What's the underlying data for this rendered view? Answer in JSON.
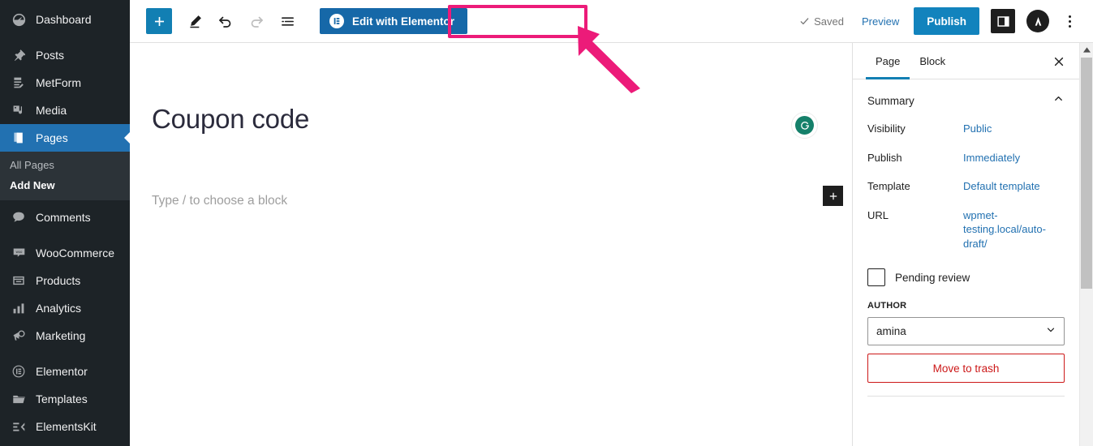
{
  "colors": {
    "admin_bg": "#1d2327",
    "admin_current": "#2271b1",
    "accent_blue": "#127fb3",
    "elementor_blue": "#1668a8",
    "highlight_pink": "#ec1b79",
    "link_blue": "#2271b1",
    "danger_red": "#cc1818",
    "grammarly_green": "#15806a"
  },
  "sidebar": {
    "items": [
      {
        "label": "Dashboard",
        "icon": "dashboard-icon",
        "current": false
      },
      {
        "label": "Posts",
        "icon": "pin-icon",
        "current": false
      },
      {
        "label": "MetForm",
        "icon": "form-icon",
        "current": false
      },
      {
        "label": "Media",
        "icon": "media-icon",
        "current": false
      },
      {
        "label": "Pages",
        "icon": "pages-icon",
        "current": true
      },
      {
        "label": "Comments",
        "icon": "comment-icon",
        "current": false
      },
      {
        "label": "WooCommerce",
        "icon": "woo-icon",
        "current": false
      },
      {
        "label": "Products",
        "icon": "products-icon",
        "current": false
      },
      {
        "label": "Analytics",
        "icon": "analytics-icon",
        "current": false
      },
      {
        "label": "Marketing",
        "icon": "megaphone-icon",
        "current": false
      },
      {
        "label": "Elementor",
        "icon": "elementor-icon",
        "current": false
      },
      {
        "label": "Templates",
        "icon": "folder-icon",
        "current": false
      },
      {
        "label": "ElementsKit",
        "icon": "elementskit-icon",
        "current": false
      }
    ],
    "submenu": [
      {
        "label": "All Pages",
        "active": false
      },
      {
        "label": "Add New",
        "active": true
      }
    ]
  },
  "toolbar": {
    "inserter_label": "+",
    "tools": [
      {
        "name": "block-inserter-button",
        "icon": "plus-icon"
      },
      {
        "name": "tools-button",
        "icon": "pencil-icon"
      },
      {
        "name": "undo-button",
        "icon": "undo-icon"
      },
      {
        "name": "redo-button",
        "icon": "redo-icon"
      },
      {
        "name": "document-overview-button",
        "icon": "list-view-icon"
      }
    ],
    "elementor_button_label": "Edit with Elementor",
    "saved_label": "Saved",
    "preview_label": "Preview",
    "publish_label": "Publish",
    "settings_toggle_name": "settings-sidebar-toggle",
    "avatar_label": "A",
    "more_menu_name": "options-menu"
  },
  "canvas": {
    "post_title": "Coupon code",
    "block_placeholder": "Type / to choose a block",
    "grammarly_label": "G",
    "inserter_label": "+"
  },
  "settings_panel": {
    "tabs": [
      {
        "label": "Page",
        "active": true
      },
      {
        "label": "Block",
        "active": false
      }
    ],
    "close_label": "×",
    "summary": {
      "title": "Summary",
      "rows": [
        {
          "key": "Visibility",
          "value": "Public"
        },
        {
          "key": "Publish",
          "value": "Immediately"
        },
        {
          "key": "Template",
          "value": "Default template"
        },
        {
          "key": "URL",
          "value": "wpmet-testing.local/auto-draft/"
        }
      ]
    },
    "pending_review_label": "Pending review",
    "author_label": "AUTHOR",
    "author_value": "amina",
    "author_options": [
      "amina"
    ],
    "trash_label": "Move to trash"
  },
  "annotation": {
    "type": "arrow",
    "color": "#ec1b79",
    "points_to": "Edit with Elementor"
  }
}
